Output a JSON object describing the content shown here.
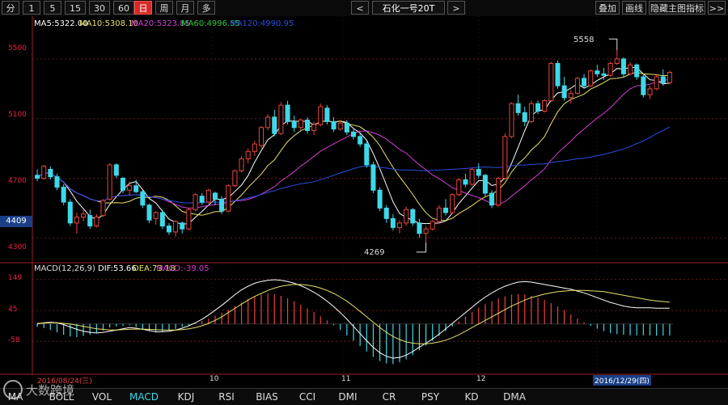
{
  "toolbar": {
    "periods": [
      "分",
      "1",
      "5",
      "15",
      "30",
      "60",
      "日",
      "周",
      "月",
      "多"
    ],
    "active_period": "日",
    "prev": "<",
    "next": ">",
    "symbol": "石化一号20T",
    "right_buttons": [
      "叠加",
      "画线",
      "隐藏主图指标",
      ">>"
    ]
  },
  "ma_legend": {
    "ma5": "MA5:5322.00",
    "ma10": "MA10:5308.10",
    "ma20": "MA20:5323.85",
    "ma60": "MA60:4996.55",
    "ma120": "MA120:4990.95"
  },
  "colors": {
    "ma5": "#ffffff",
    "ma10": "#e8e06a",
    "ma20": "#d43fd4",
    "ma60": "#2ecc40",
    "ma120": "#2b4ee0",
    "up": "#e8453c",
    "down": "#3fd8e8",
    "axis": "#e8453c"
  },
  "price_axis": [
    "5500",
    "5100",
    "4700",
    "4300"
  ],
  "current_price_tag": "4409",
  "annotations": {
    "high": "5558",
    "low": "4269"
  },
  "macd_legend": {
    "name": "MACD(12,26,9)",
    "dif": "DIF:53.66",
    "dea": "DEA:73.18",
    "macd": "MACD:-39.05"
  },
  "macd_axis": [
    "149",
    "45",
    "-58"
  ],
  "dates": {
    "start": "2016/08/24(三)",
    "m10": "10",
    "m11": "11",
    "m12": "12",
    "end": "2016/12/29(四)"
  },
  "bottom_tabs": [
    "MA",
    "BOLL",
    "VOL",
    "MACD",
    "KDJ",
    "RSI",
    "BIAS",
    "CCI",
    "DMI",
    "CR",
    "PSY",
    "KD",
    "DMA"
  ],
  "active_tab": "MACD",
  "watermark": "大数跨境",
  "chart_data": {
    "type": "candlestick",
    "title": "",
    "ylim": [
      4150,
      5700
    ],
    "candles": [
      [
        4720,
        4760,
        4680,
        4700
      ],
      [
        4700,
        4790,
        4690,
        4780
      ],
      [
        4760,
        4780,
        4690,
        4710
      ],
      [
        4710,
        4730,
        4620,
        4640
      ],
      [
        4640,
        4660,
        4520,
        4540
      ],
      [
        4540,
        4560,
        4380,
        4400
      ],
      [
        4400,
        4470,
        4330,
        4440
      ],
      [
        4440,
        4490,
        4410,
        4460
      ],
      [
        4450,
        4490,
        4360,
        4380
      ],
      [
        4380,
        4460,
        4370,
        4440
      ],
      [
        4450,
        4560,
        4440,
        4550
      ],
      [
        4560,
        4800,
        4550,
        4790
      ],
      [
        4790,
        4800,
        4700,
        4720
      ],
      [
        4700,
        4710,
        4600,
        4620
      ],
      [
        4620,
        4680,
        4590,
        4650
      ],
      [
        4650,
        4690,
        4600,
        4610
      ],
      [
        4610,
        4620,
        4500,
        4520
      ],
      [
        4520,
        4530,
        4400,
        4420
      ],
      [
        4430,
        4480,
        4390,
        4470
      ],
      [
        4470,
        4490,
        4360,
        4380
      ],
      [
        4380,
        4400,
        4320,
        4340
      ],
      [
        4340,
        4420,
        4310,
        4410
      ],
      [
        4400,
        4410,
        4330,
        4360
      ],
      [
        4360,
        4500,
        4350,
        4490
      ],
      [
        4490,
        4600,
        4480,
        4590
      ],
      [
        4580,
        4600,
        4520,
        4540
      ],
      [
        4540,
        4630,
        4530,
        4620
      ],
      [
        4600,
        4610,
        4520,
        4560
      ],
      [
        4560,
        4580,
        4460,
        4480
      ],
      [
        4480,
        4660,
        4470,
        4650
      ],
      [
        4650,
        4760,
        4640,
        4750
      ],
      [
        4750,
        4850,
        4740,
        4830
      ],
      [
        4830,
        4900,
        4800,
        4880
      ],
      [
        4880,
        4950,
        4850,
        4930
      ],
      [
        4920,
        5050,
        4900,
        5040
      ],
      [
        5040,
        5130,
        5020,
        5110
      ],
      [
        5110,
        5160,
        4980,
        5000
      ],
      [
        5000,
        5210,
        4990,
        5190
      ],
      [
        5190,
        5220,
        5060,
        5080
      ],
      [
        5080,
        5120,
        5010,
        5040
      ],
      [
        5040,
        5100,
        5020,
        5090
      ],
      [
        5090,
        5110,
        5000,
        5020
      ],
      [
        5020,
        5080,
        4990,
        5060
      ],
      [
        5060,
        5200,
        5050,
        5180
      ],
      [
        5170,
        5190,
        5060,
        5080
      ],
      [
        5080,
        5110,
        5010,
        5030
      ],
      [
        5030,
        5090,
        5020,
        5070
      ],
      [
        5070,
        5090,
        4990,
        5010
      ],
      [
        5010,
        5030,
        4960,
        4980
      ],
      [
        4980,
        5000,
        4910,
        4930
      ],
      [
        4930,
        4950,
        4770,
        4790
      ],
      [
        4790,
        4810,
        4600,
        4620
      ],
      [
        4620,
        4640,
        4480,
        4500
      ],
      [
        4500,
        4520,
        4400,
        4430
      ],
      [
        4430,
        4460,
        4350,
        4370
      ],
      [
        4370,
        4420,
        4330,
        4400
      ],
      [
        4400,
        4510,
        4380,
        4490
      ],
      [
        4490,
        4500,
        4380,
        4400
      ],
      [
        4400,
        4430,
        4300,
        4330
      ],
      [
        4330,
        4380,
        4270,
        4360
      ],
      [
        4360,
        4420,
        4350,
        4410
      ],
      [
        4410,
        4520,
        4400,
        4500
      ],
      [
        4500,
        4560,
        4450,
        4470
      ],
      [
        4470,
        4600,
        4460,
        4590
      ],
      [
        4590,
        4700,
        4580,
        4690
      ],
      [
        4690,
        4730,
        4640,
        4660
      ],
      [
        4660,
        4770,
        4650,
        4760
      ],
      [
        4760,
        4800,
        4700,
        4720
      ],
      [
        4720,
        4730,
        4580,
        4600
      ],
      [
        4600,
        4620,
        4500,
        4520
      ],
      [
        4520,
        4710,
        4510,
        4700
      ],
      [
        4700,
        5000,
        4690,
        4980
      ],
      [
        4980,
        5210,
        4970,
        5200
      ],
      [
        5200,
        5260,
        5120,
        5140
      ],
      [
        5140,
        5180,
        5050,
        5080
      ],
      [
        5080,
        5220,
        5070,
        5200
      ],
      [
        5200,
        5220,
        5130,
        5150
      ],
      [
        5150,
        5230,
        5140,
        5220
      ],
      [
        5220,
        5480,
        5210,
        5470
      ],
      [
        5470,
        5490,
        5300,
        5320
      ],
      [
        5320,
        5380,
        5220,
        5240
      ],
      [
        5240,
        5290,
        5200,
        5270
      ],
      [
        5270,
        5380,
        5260,
        5370
      ],
      [
        5370,
        5400,
        5300,
        5320
      ],
      [
        5320,
        5430,
        5310,
        5420
      ],
      [
        5420,
        5460,
        5380,
        5400
      ],
      [
        5400,
        5440,
        5360,
        5390
      ],
      [
        5390,
        5480,
        5380,
        5470
      ],
      [
        5470,
        5558,
        5460,
        5500
      ],
      [
        5500,
        5510,
        5380,
        5400
      ],
      [
        5400,
        5480,
        5390,
        5460
      ],
      [
        5460,
        5470,
        5360,
        5380
      ],
      [
        5380,
        5400,
        5240,
        5260
      ],
      [
        5260,
        5320,
        5230,
        5300
      ],
      [
        5300,
        5400,
        5290,
        5380
      ],
      [
        5380,
        5430,
        5320,
        5340
      ],
      [
        5340,
        5420,
        5330,
        5410
      ]
    ],
    "macd_hist": [
      -10,
      -14,
      -20,
      -28,
      -36,
      -42,
      -44,
      -40,
      -36,
      -30,
      -22,
      -12,
      -8,
      -6,
      -4,
      -10,
      -18,
      -24,
      -28,
      -26,
      -22,
      -16,
      -10,
      -4,
      4,
      10,
      18,
      28,
      38,
      48,
      60,
      72,
      84,
      92,
      98,
      102,
      100,
      94,
      86,
      76,
      64,
      52,
      40,
      26,
      12,
      -4,
      -20,
      -38,
      -56,
      -74,
      -92,
      -110,
      -124,
      -132,
      -134,
      -128,
      -118,
      -104,
      -88,
      -72,
      -56,
      -40,
      -24,
      -8,
      8,
      24,
      40,
      54,
      66,
      76,
      86,
      92,
      98,
      100,
      98,
      94,
      88,
      80,
      70,
      58,
      46,
      32,
      18,
      6,
      -6,
      -16,
      -24,
      -30,
      -34,
      -36,
      -38,
      -38,
      -38,
      -38,
      -39,
      -39,
      -39
    ],
    "dif": [
      0,
      4,
      6,
      4,
      -2,
      -10,
      -18,
      -24,
      -28,
      -30,
      -28,
      -24,
      -20,
      -16,
      -12,
      -14,
      -18,
      -22,
      -26,
      -26,
      -24,
      -20,
      -14,
      -6,
      4,
      16,
      30,
      46,
      62,
      80,
      98,
      114,
      126,
      136,
      142,
      146,
      148,
      146,
      142,
      136,
      128,
      118,
      106,
      92,
      76,
      58,
      38,
      16,
      -8,
      -32,
      -56,
      -78,
      -96,
      -108,
      -114,
      -112,
      -104,
      -92,
      -78,
      -64,
      -50,
      -34,
      -16,
      2,
      20,
      38,
      56,
      74,
      90,
      104,
      116,
      126,
      134,
      140,
      142,
      140,
      136,
      132,
      128,
      124,
      120,
      116,
      110,
      104,
      96,
      88,
      80,
      72,
      66,
      60,
      56,
      54,
      54,
      54,
      53,
      53,
      53
    ],
    "dea": [
      2,
      3,
      4,
      4,
      2,
      0,
      -4,
      -8,
      -12,
      -16,
      -18,
      -20,
      -20,
      -19,
      -18,
      -17,
      -17,
      -18,
      -19,
      -20,
      -20,
      -20,
      -19,
      -16,
      -12,
      -6,
      2,
      12,
      24,
      38,
      52,
      66,
      80,
      92,
      102,
      112,
      120,
      126,
      130,
      132,
      132,
      130,
      126,
      120,
      112,
      102,
      90,
      76,
      60,
      42,
      24,
      6,
      -12,
      -28,
      -42,
      -52,
      -60,
      -64,
      -66,
      -66,
      -64,
      -60,
      -54,
      -46,
      -36,
      -24,
      -12,
      0,
      12,
      24,
      36,
      48,
      60,
      70,
      80,
      88,
      94,
      100,
      104,
      108,
      110,
      112,
      112,
      112,
      111,
      110,
      108,
      104,
      100,
      96,
      92,
      88,
      84,
      80,
      77,
      75,
      73
    ]
  }
}
